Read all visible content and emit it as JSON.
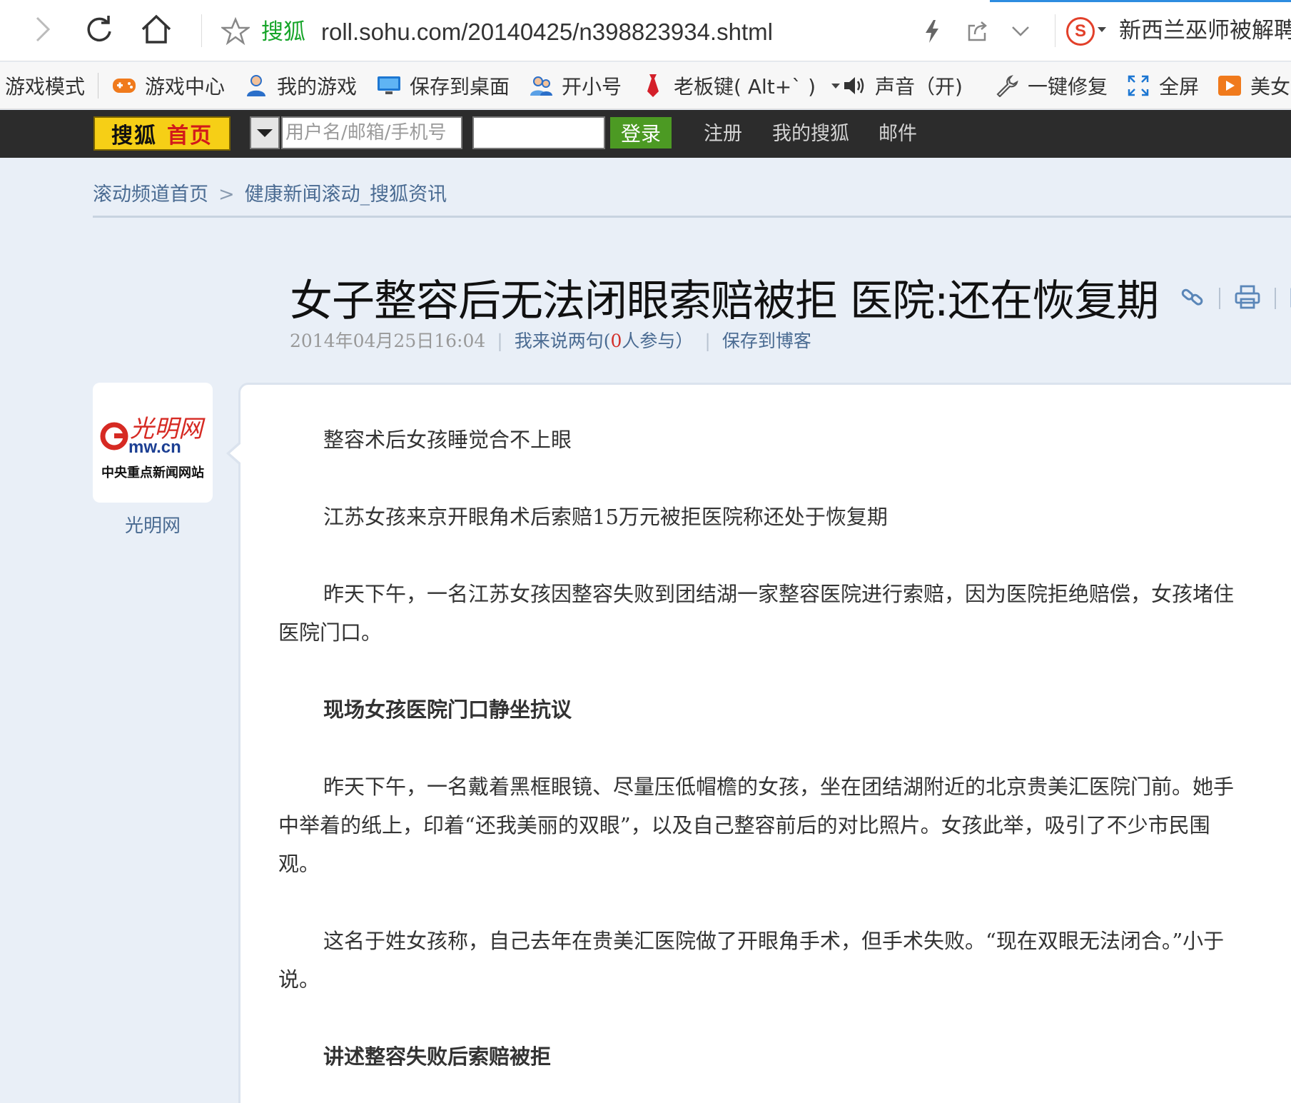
{
  "browser": {
    "site_label": "搜狐",
    "url": "roll.sohu.com/20140425/n398823934.shtml",
    "search_hot": "新西兰巫师被解聘",
    "accent_color": "#2d8ce0"
  },
  "toolbar": {
    "game_mode": "游戏模式",
    "game_center": "游戏中心",
    "my_games": "我的游戏",
    "save_desktop": "保存到桌面",
    "open_account": "开小号",
    "boss_key": "老板键( Alt+` )",
    "sound": "声音（开)",
    "repair": "一键修复",
    "fullscreen": "全屏",
    "beauty": "美女"
  },
  "sohu_bar": {
    "home_a": "搜狐",
    "home_b": "首页",
    "username_placeholder": "用户名/邮箱/手机号",
    "login": "登录",
    "register": "注册",
    "my_sohu": "我的搜狐",
    "mail": "邮件"
  },
  "breadcrumb": {
    "home": "滚动频道首页",
    "sep": ">",
    "channel": "健康新闻滚动_搜狐资讯"
  },
  "article": {
    "title": "女子整容后无法闭眼索赔被拒 医院:还在恢复期",
    "date": "2014年04月25日16:04",
    "comment_prefix": "我来说两句(",
    "comment_count": "0",
    "comment_suffix": "人参与）",
    "save_blog": "保存到博客",
    "source": {
      "logo_text": "光明网",
      "logo_domain": "mw.cn",
      "logo_tagline": "中央重点新闻网站",
      "name": "光明网"
    },
    "paragraphs": [
      {
        "text": "整容术后女孩睡觉合不上眼",
        "bold": false
      },
      {
        "text": "江苏女孩来京开眼角术后索赔15万元被拒医院称还处于恢复期",
        "bold": false
      },
      {
        "text": "昨天下午，一名江苏女孩因整容失败到团结湖一家整容医院进行索赔，因为医院拒绝赔偿，女孩堵住医院门口。",
        "bold": false
      },
      {
        "text": "现场女孩医院门口静坐抗议",
        "bold": true
      },
      {
        "text": "昨天下午，一名戴着黑框眼镜、尽量压低帽檐的女孩，坐在团结湖附近的北京贵美汇医院门前。她手中举着的纸上，印着“还我美丽的双眼”，以及自己整容前后的对比照片。女孩此举，吸引了不少市民围观。",
        "bold": false
      },
      {
        "text": "这名于姓女孩称，自己去年在贵美汇医院做了开眼角手术，但手术失败。“现在双眼无法闭合。”小于说。",
        "bold": false
      },
      {
        "text": "讲述整容失败后索赔被拒",
        "bold": true
      }
    ]
  }
}
